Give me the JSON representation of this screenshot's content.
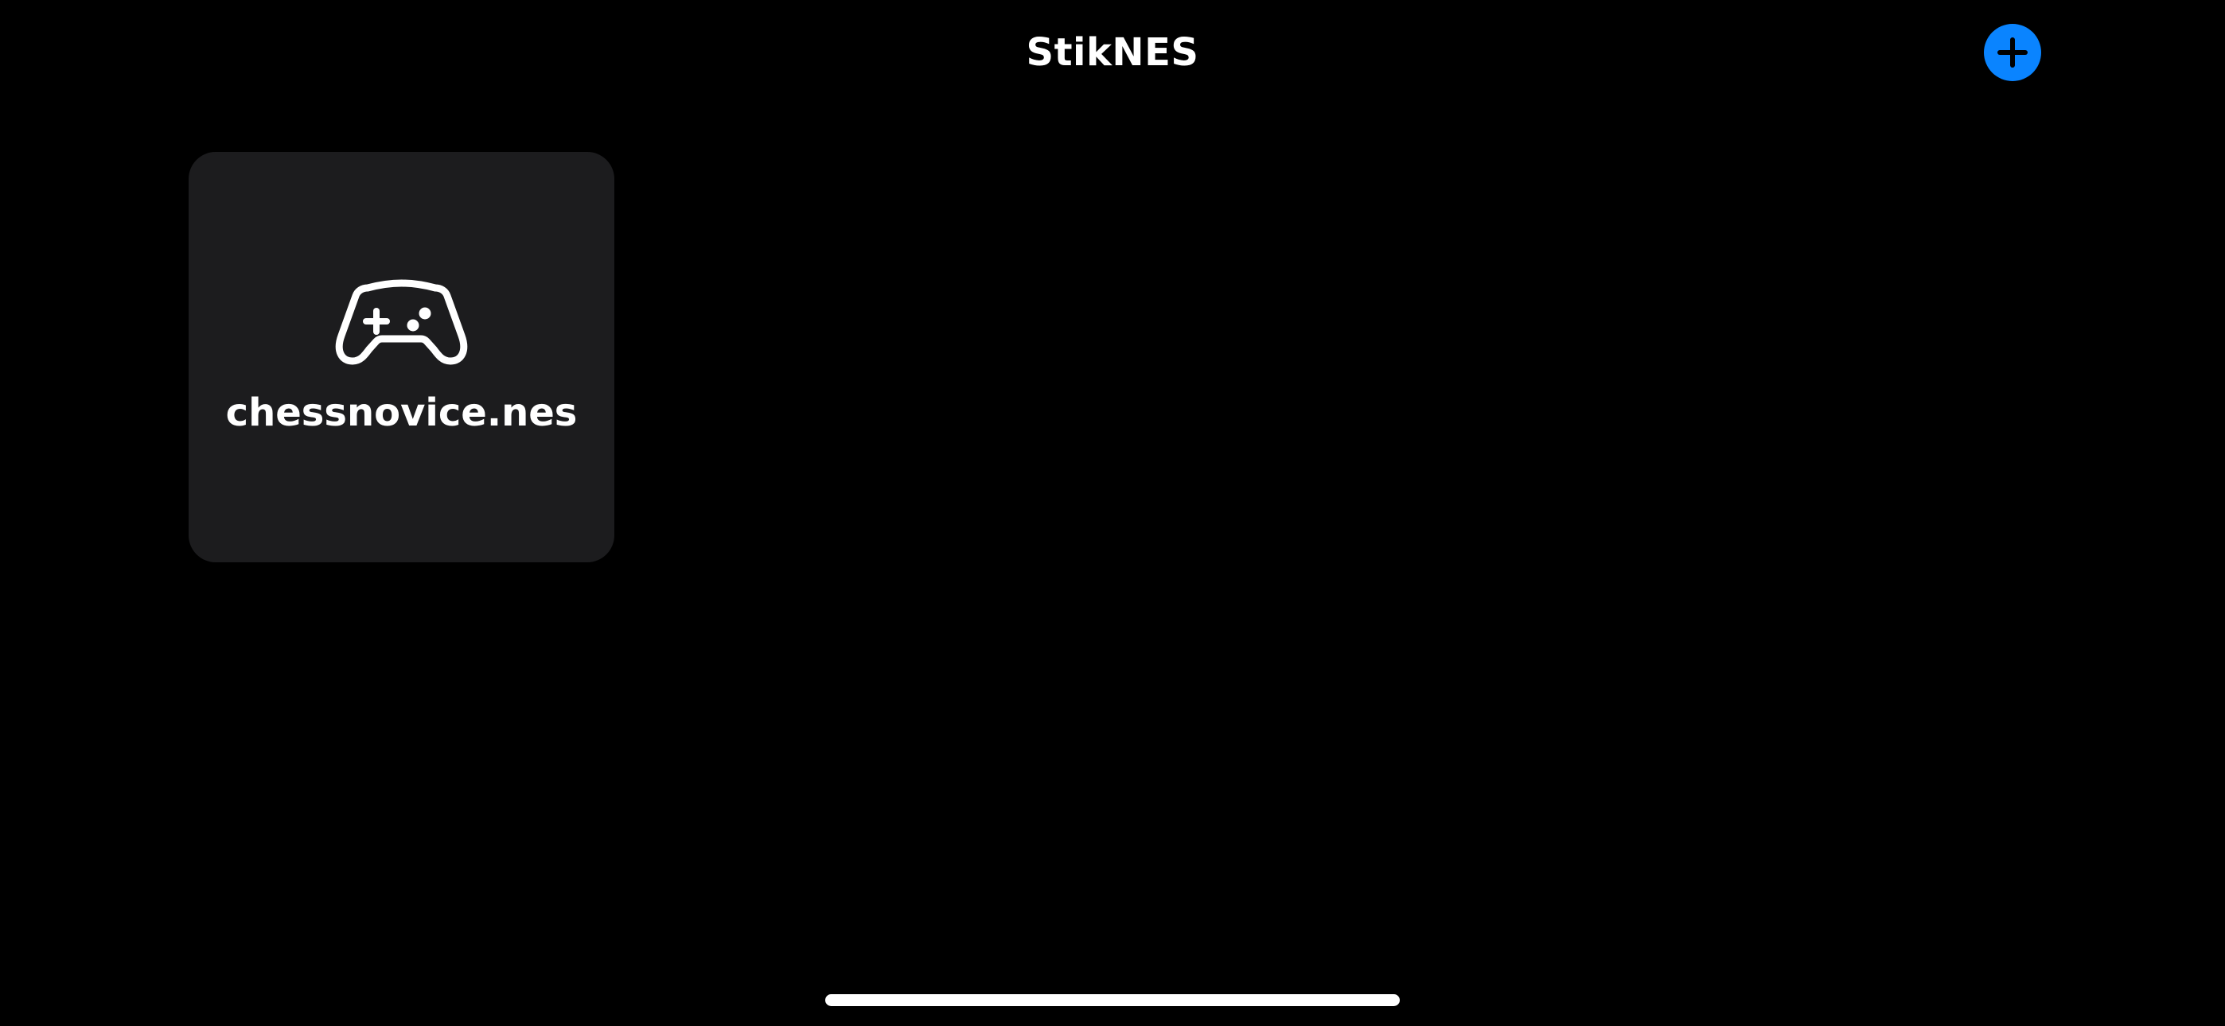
{
  "app": {
    "title": "StikNES"
  },
  "toolbar": {
    "add_icon": "plus-icon",
    "accent_color": "#0a84ff"
  },
  "library": {
    "items": [
      {
        "name": "chessnovice.nes",
        "icon": "gamecontroller-icon"
      }
    ]
  },
  "colors": {
    "background": "#000000",
    "tile_background": "#1c1c1e",
    "text": "#ffffff"
  }
}
